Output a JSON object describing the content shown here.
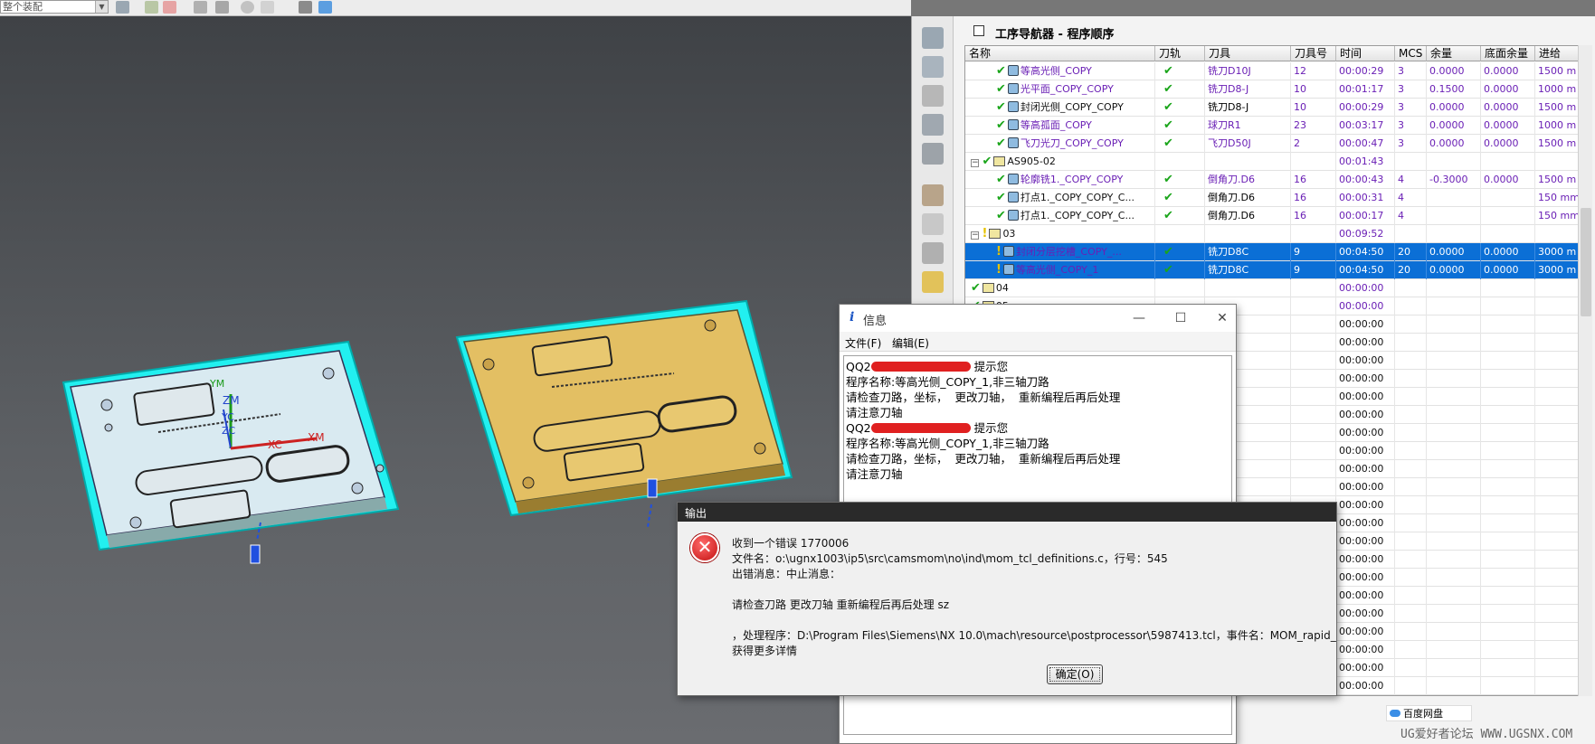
{
  "toolbar": {
    "filter_value": "整个装配"
  },
  "viewport": {
    "axes": {
      "ym": "YM",
      "zm": "ZM",
      "yc": "YC",
      "zc": "ZC",
      "xc": "XC",
      "xm": "XM"
    },
    "colors": {
      "part_left": "#d9eaf1",
      "part_right": "#e3bf63",
      "fixture": "#22f0f0"
    }
  },
  "navigator": {
    "title": "工序导航器 - 程序顺序",
    "columns": [
      "名称",
      "刀轨",
      "刀具",
      "刀具号",
      "时间",
      "MCS",
      "余量",
      "底面余量",
      "进给"
    ],
    "rows": [
      {
        "name": "等高光侧_COPY",
        "status": "ok",
        "path": "ok",
        "tool": "铣刀D10J",
        "tool_no": "12",
        "time": "00:00:29",
        "mcs": "3",
        "stock": "0.0000",
        "floor": "0.0000",
        "feed": "1500 m",
        "level": 2,
        "tool_color": "purple",
        "selected": false
      },
      {
        "name": "光平面_COPY_COPY",
        "status": "ok",
        "path": "ok",
        "tool": "铣刀D8-J",
        "tool_no": "10",
        "time": "00:01:17",
        "mcs": "3",
        "stock": "0.1500",
        "floor": "0.0000",
        "feed": "1000 m",
        "level": 2,
        "tool_color": "purple",
        "selected": false
      },
      {
        "name": "封闭光侧_COPY_COPY",
        "status": "ok",
        "path": "ok",
        "tool": "铣刀D8-J",
        "tool_no": "10",
        "time": "00:00:29",
        "mcs": "3",
        "stock": "0.0000",
        "floor": "0.0000",
        "feed": "1500 m",
        "level": 2,
        "tool_color": "black",
        "name_color": "black",
        "selected": false
      },
      {
        "name": "等高孤面_COPY",
        "status": "ok",
        "path": "ok",
        "tool": "球刀R1",
        "tool_no": "23",
        "time": "00:03:17",
        "mcs": "3",
        "stock": "0.0000",
        "floor": "0.0000",
        "feed": "1000 m",
        "level": 2,
        "tool_color": "purple",
        "selected": false
      },
      {
        "name": "飞刀光刀_COPY_COPY",
        "status": "ok",
        "path": "ok",
        "tool": "飞刀D50J",
        "tool_no": "2",
        "time": "00:00:47",
        "mcs": "3",
        "stock": "0.0000",
        "floor": "0.0000",
        "feed": "1500 m",
        "level": 2,
        "tool_color": "purple",
        "selected": false
      },
      {
        "name": "AS905-02",
        "status": "ok",
        "path": "",
        "tool": "",
        "tool_no": "",
        "time": "00:01:43",
        "mcs": "",
        "stock": "",
        "floor": "",
        "feed": "",
        "level": 1,
        "group": true,
        "tool_color": "black",
        "name_color": "black",
        "selected": false
      },
      {
        "name": "轮廓铣1._COPY_COPY",
        "status": "ok",
        "path": "ok",
        "tool": "倒角刀.D6",
        "tool_no": "16",
        "time": "00:00:43",
        "mcs": "4",
        "stock": "-0.3000",
        "floor": "0.0000",
        "feed": "1500 m",
        "level": 2,
        "tool_color": "purple",
        "selected": false
      },
      {
        "name": "打点1._COPY_COPY_C...",
        "status": "ok",
        "path": "ok",
        "tool": "倒角刀.D6",
        "tool_no": "16",
        "time": "00:00:31",
        "mcs": "4",
        "stock": "",
        "floor": "",
        "feed": "150 mm",
        "level": 2,
        "tool_color": "black",
        "name_color": "black",
        "selected": false
      },
      {
        "name": "打点1._COPY_COPY_C...",
        "status": "ok",
        "path": "ok",
        "tool": "倒角刀.D6",
        "tool_no": "16",
        "time": "00:00:17",
        "mcs": "4",
        "stock": "",
        "floor": "",
        "feed": "150 mm",
        "level": 2,
        "tool_color": "black",
        "name_color": "black",
        "selected": false
      },
      {
        "name": "03",
        "status": "warn",
        "path": "",
        "tool": "",
        "tool_no": "",
        "time": "00:09:52",
        "mcs": "",
        "stock": "",
        "floor": "",
        "feed": "",
        "level": 1,
        "group": true,
        "tool_color": "black",
        "name_color": "black",
        "selected": false
      },
      {
        "name": "封闭分层挖槽_COPY_...",
        "status": "warn",
        "path": "ok",
        "tool": "铣刀D8C",
        "tool_no": "9",
        "time": "00:04:50",
        "mcs": "20",
        "stock": "0.0000",
        "floor": "0.0000",
        "feed": "3000 m",
        "level": 2,
        "tool_color": "black",
        "selected": true
      },
      {
        "name": "等高光侧_COPY_1",
        "status": "warn",
        "path": "ok",
        "tool": "铣刀D8C",
        "tool_no": "9",
        "time": "00:04:50",
        "mcs": "20",
        "stock": "0.0000",
        "floor": "0.0000",
        "feed": "3000 m",
        "level": 2,
        "tool_color": "black",
        "selected": true
      },
      {
        "name": "04",
        "status": "ok",
        "path": "",
        "tool": "",
        "tool_no": "",
        "time": "00:00:00",
        "mcs": "",
        "stock": "",
        "floor": "",
        "feed": "",
        "level": 1,
        "group": true,
        "tool_color": "black",
        "name_color": "black",
        "selected": false
      },
      {
        "name": "05",
        "status": "ok",
        "path": "",
        "tool": "",
        "tool_no": "",
        "time": "00:00:00",
        "mcs": "",
        "stock": "",
        "floor": "",
        "feed": "",
        "level": 1,
        "group": true,
        "tool_color": "black",
        "name_color": "black",
        "selected": false
      }
    ],
    "empty_time": "00:00:00"
  },
  "info_window": {
    "title": "信息",
    "menu": [
      "文件(F)",
      "编辑(E)"
    ],
    "lines": [
      {
        "pre": "QQ2",
        "suffix": " 提示您",
        "redacted": true
      },
      {
        "text": "程序名称:等高光侧_COPY_1,非三轴刀路"
      },
      {
        "text": "请检查刀路，坐标，  更改刀轴，  重新编程后再后处理"
      },
      {
        "text": "请注意刀轴"
      },
      {
        "pre": "QQ2",
        "suffix": " 提示您",
        "redacted": true
      },
      {
        "text": "程序名称:等高光侧_COPY_1,非三轴刀路"
      },
      {
        "text": "请检查刀路，坐标，  更改刀轴，  重新编程后再后处理"
      },
      {
        "text": "请注意刀轴"
      }
    ]
  },
  "output_dialog": {
    "title": "输出",
    "line1": "收到一个错误 1770006",
    "line2": "文件名：o:\\ugnx1003\\ip5\\src\\camsmom\\no\\ind\\mom_tcl_definitions.c，行号：545",
    "line3": "出错消息：中止消息：",
    "line4": " 请检查刀路 更改刀轴 重新编程后再后处理 sz",
    "line5": "，处理程序：D:\\Program Files\\Siemens\\NX 10.0\\mach\\resource\\postprocessor\\5987413.tcl，事件名：MOM_rapid_",
    "line6": "获得更多详情",
    "ok_label": "确定(O)"
  },
  "baidu": "百度网盘",
  "watermark": "UG爱好者论坛  WWW.UGSNX.COM"
}
